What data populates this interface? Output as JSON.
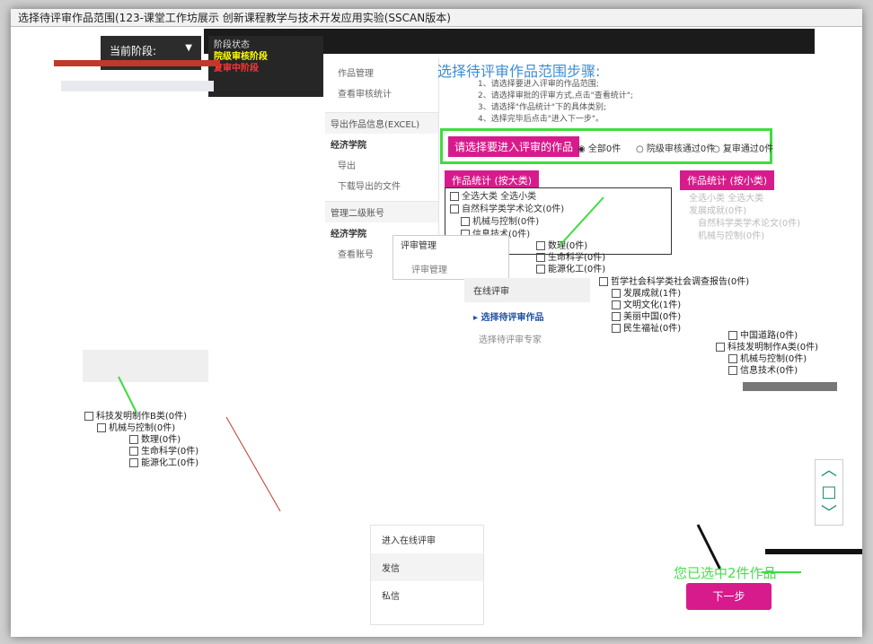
{
  "window": {
    "title": "选择待评审作品范围(123-课堂工作坊展示 创新课程教学与技术开发应用实验(SSCAN版本)"
  },
  "header": {
    "stage_label": "当前阶段:",
    "submenu": [
      "阶段状态",
      "院级审核阶段",
      "复审中阶段"
    ]
  },
  "sidebar": {
    "top_items": [
      "作品管理",
      "查看审核统计"
    ],
    "sections": [
      {
        "title": "导出作品信息(EXCEL)",
        "bold": "经济学院",
        "items": [
          "导出",
          "下载导出的文件"
        ]
      },
      {
        "title": "管理二级账号",
        "bold": "经济学院",
        "items": [
          "查看账号"
        ]
      }
    ]
  },
  "steps": {
    "title": "选择待评审作品范围步骤:",
    "items": [
      "1、请选择要进入评审的作品范围;",
      "2、请选择审批的评审方式,点击\"查看统计\";",
      "3、请选择\"作品统计\"下的具体类别;",
      "4、选择完毕后点击\"进入下一步\"。"
    ]
  },
  "range_select": {
    "label": "请选择要进入评审的作品",
    "options": [
      "全部0件",
      "院级审核通过0件",
      "复审通过0件"
    ]
  },
  "category_tabs": {
    "major": "作品统计 (按大类)",
    "minor": "作品统计 (按小类)"
  },
  "major_list": [
    "全选大类  全选小类",
    "自然科学类学术论文(0件)",
    "机械与控制(0件)",
    "信息技术(0件)"
  ],
  "minor_faint": [
    "全选小类  全选大类",
    "发展成就(0件)",
    "自然科学类学术论文(0件)",
    "机械与控制(0件)"
  ],
  "fragments": {
    "mid": [
      "数理(0件)",
      "生命科学(0件)",
      "能源化工(0件)"
    ],
    "right": [
      "哲学社会科学类社会调查报告(0件)",
      "发展成就(1件)",
      "文明文化(1件)",
      "美丽中国(0件)",
      "民生福祉(0件)"
    ],
    "right2": [
      "中国道路(0件)",
      "科技发明制作A类(0件)",
      "机械与控制(0件)",
      "信息技术(0件)"
    ],
    "left": [
      "科技发明制作B类(0件)",
      "机械与控制(0件)",
      "数理(0件)",
      "生命科学(0件)",
      "能源化工(0件)"
    ]
  },
  "review_mgmt": {
    "header": "评审管理",
    "item": "评审管理"
  },
  "online_review": {
    "header": "在线评审",
    "active": "选择待评审作品",
    "sub": "选择待评审专家"
  },
  "bottom_nav": [
    "进入在线评审",
    "发信",
    "私信"
  ],
  "side_tools": [
    "︿",
    "□",
    "﹀"
  ],
  "result": {
    "count_text": "您已选中2件作品",
    "next_label": "下一步"
  }
}
